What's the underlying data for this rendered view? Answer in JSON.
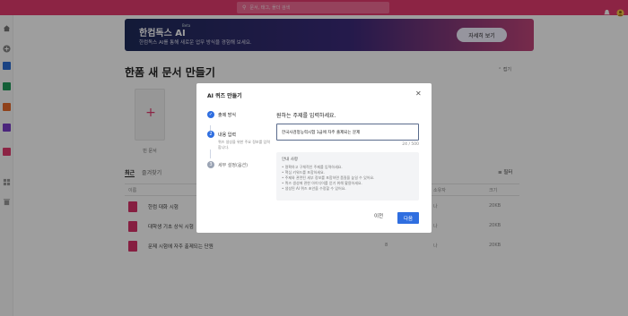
{
  "colors": {
    "brand": "#e23a6e",
    "primary_button": "#2f6ee0",
    "step_active": "#2f6ee0",
    "step_inactive": "#9aa3b3",
    "document_icon": "#d9336a"
  },
  "topbar": {
    "search_placeholder": "문서, 태그, 폴더 검색",
    "icons": [
      "search-icon",
      "bell-icon",
      "avatar"
    ]
  },
  "sidebar": {
    "icons": [
      "home-icon",
      "add-icon",
      "app-icon-word",
      "app-icon-sheet",
      "app-icon-slide",
      "app-icon-pdf",
      "app-icon-quiz",
      "apps-grid-icon",
      "trash-icon"
    ]
  },
  "banner": {
    "title": "한컴독스 AI",
    "beta": "Beta",
    "subtitle": "한컴독스 AI를 통해 새로운 업무 방식을 경험해 보세요.",
    "button": "자세히 보기"
  },
  "main": {
    "title": "한폼 새 문서 만들기",
    "collapse_label": "접기",
    "new_card_label": "빈 문서",
    "tabs": [
      "최근",
      "즐겨찾기"
    ],
    "filter_label": "필터",
    "columns": {
      "name": "이름",
      "owner": "소유자",
      "size": "크기"
    },
    "rows": [
      {
        "name": "한컴 대화 시험",
        "date": "8",
        "owner": "나",
        "size": "20KB"
      },
      {
        "name": "대학생 기초 상식 시험",
        "date": "8",
        "owner": "나",
        "size": "20KB"
      },
      {
        "name": "문제 시험에 자주 출제되는 단원",
        "date": "8",
        "owner": "나",
        "size": "20KB"
      }
    ]
  },
  "modal": {
    "title": "AI 퀴즈 만들기",
    "steps": [
      {
        "label": "출제 방식",
        "state": "done"
      },
      {
        "label": "내용 입력",
        "desc": "퀴즈 생성을 위한 주요 정보를 입력합니다.",
        "state": "active"
      },
      {
        "label": "세부 설정(옵션)",
        "state": "inactive"
      }
    ],
    "content_heading": "원하는 주제를 입력하세요.",
    "topic_value": "한국사검정능력시험 1급에 자주 출제되는 문제",
    "counter": "24 / 500",
    "guide_title": "안내 사항",
    "guide_items": [
      "명확하고 구체적인 주제를 입력하세요.",
      "핵심 키워드를 포함하세요.",
      "주제와 관련된 세부 정보를 포함하면 품질을 높일 수 있어요.",
      "퀴즈 생성에 관한 아이디어를 얻기 위해 활용하세요.",
      "생성된 AI 퀴즈 초안을 수정할 수 있어요."
    ],
    "prev_label": "이전",
    "next_label": "다음"
  }
}
